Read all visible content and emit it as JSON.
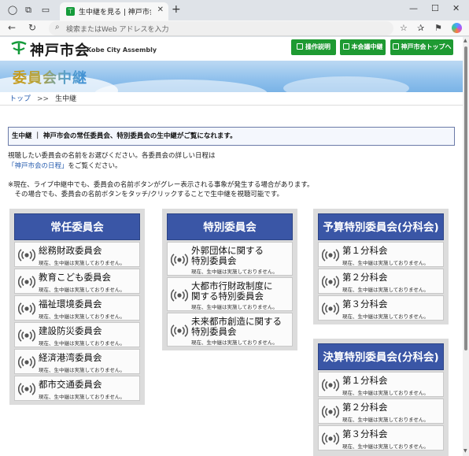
{
  "browser": {
    "tab_title": "生中継を見る | 神戸市会 委員会中継",
    "tab_close": "✕",
    "new_tab": "+",
    "address_placeholder": "検索またはWeb アドレスを入力",
    "window_controls": [
      "—",
      "☐",
      "✕"
    ]
  },
  "header": {
    "logo_jp": "神戸市会",
    "logo_en": "Kobe City Assembly",
    "buttons": [
      "操作説明",
      "本会議中継",
      "神戸市会トップへ"
    ],
    "accent": "#1e9a32"
  },
  "banner": {
    "title": "委員会中継"
  },
  "breadcrumb": {
    "home": "トップ",
    "separator": ">>",
    "current": "生中継"
  },
  "notice": "生中継 ｜ 神戸市会の常任委員会、特別委員会の生中継がご覧になれます。",
  "intro": {
    "line1": "視聴したい委員会の名前をお選びください。各委員会の詳しい日程は",
    "link": "「神戸市会の日程」",
    "line2_suffix": "をご覧ください。",
    "note1": "※現在、ライブ中継中でも、委員会の名前ボタンがグレー表示される事象が発生する場合があります。",
    "note2": "　その場合でも、委員会の名前ボタンをタッチ/クリックすることで生中継を視聴可能です。"
  },
  "status_text": "現在、生中継は実施しておりません。",
  "panels": {
    "standing": {
      "title": "常任委員会",
      "items": [
        "総務財政委員会",
        "教育こども委員会",
        "福祉環境委員会",
        "建設防災委員会",
        "経済港湾委員会",
        "都市交通委員会"
      ]
    },
    "special": {
      "title": "特別委員会",
      "items": [
        [
          "外郭団体に関する",
          "特別委員会"
        ],
        [
          "大都市行財政制度に",
          "関する特別委員会"
        ],
        [
          "未来都市創造に関する",
          "特別委員会"
        ]
      ]
    },
    "budget": {
      "title": "予算特別委員会(分科会)",
      "items": [
        "第１分科会",
        "第２分科会",
        "第３分科会"
      ]
    },
    "settlement": {
      "title": "決算特別委員会(分科会)",
      "items": [
        "第１分科会",
        "第２分科会",
        "第３分科会"
      ]
    },
    "header_color": "#3a56a6"
  }
}
